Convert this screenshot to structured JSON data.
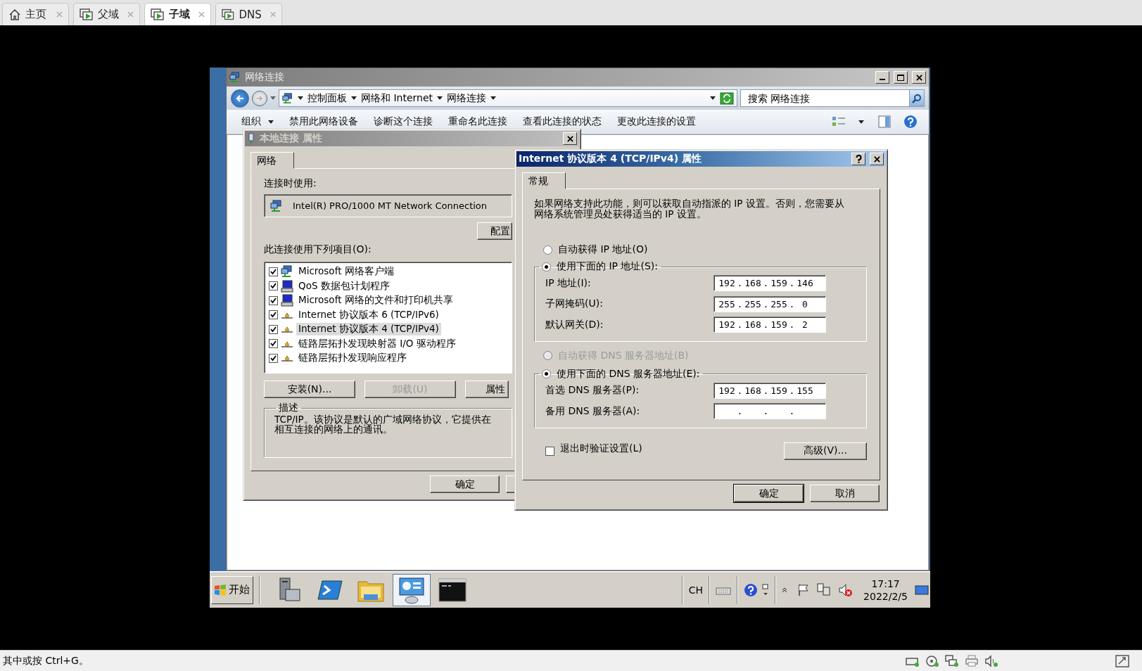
{
  "host_tabs": [
    {
      "kind": "home",
      "label": "主页",
      "selected": false
    },
    {
      "kind": "vm",
      "label": "父域",
      "selected": false
    },
    {
      "kind": "vm",
      "label": "子域",
      "selected": true
    },
    {
      "kind": "vm",
      "label": "DNS",
      "selected": false
    }
  ],
  "explorer": {
    "title": "网络连接",
    "breadcrumb": [
      "控制面板",
      "网络和 Internet",
      "网络连接"
    ],
    "search": {
      "placeholder": "搜索 网络连接"
    },
    "commands": [
      {
        "label": "组织",
        "menu": true
      },
      {
        "label": "禁用此网络设备",
        "menu": false
      },
      {
        "label": "诊断这个连接",
        "menu": false
      },
      {
        "label": "重命名此连接",
        "menu": false
      },
      {
        "label": "查看此连接的状态",
        "menu": false
      },
      {
        "label": "更改此连接的设置",
        "menu": false
      }
    ]
  },
  "local_dialog": {
    "title": "本地连接 属性",
    "tabs": [
      {
        "label": "网络",
        "selected": true
      }
    ],
    "connect_label": "连接时使用:",
    "adapter": "Intel(R) PRO/1000 MT Network Connection",
    "configure_button": "配置",
    "items_label": "此连接使用下列项目(O):",
    "items": [
      {
        "kind": "client",
        "label": "Microsoft 网络客户端",
        "checked": true,
        "selected": false
      },
      {
        "kind": "service",
        "label": "QoS 数据包计划程序",
        "checked": true,
        "selected": false
      },
      {
        "kind": "service",
        "label": "Microsoft 网络的文件和打印机共享",
        "checked": true,
        "selected": false
      },
      {
        "kind": "protocol",
        "label": "Internet 协议版本 6 (TCP/IPv6)",
        "checked": true,
        "selected": false
      },
      {
        "kind": "protocol",
        "label": "Internet 协议版本 4 (TCP/IPv4)",
        "checked": true,
        "selected": true
      },
      {
        "kind": "protocol",
        "label": "链路层拓扑发现映射器 I/O 驱动程序",
        "checked": true,
        "selected": false
      },
      {
        "kind": "protocol",
        "label": "链路层拓扑发现响应程序",
        "checked": true,
        "selected": false
      }
    ],
    "buttons": [
      {
        "label": "安装(N)...",
        "disabled": false
      },
      {
        "label": "卸载(U)",
        "disabled": true
      },
      {
        "label": "属性",
        "disabled": false
      }
    ],
    "description": {
      "legend": "描述",
      "lines": [
        "TCP/IP。该协议是默认的广域网络协议，它提供在",
        "相互连接的网络上的通讯。"
      ]
    },
    "ok_button": "确定"
  },
  "ipv4_dialog": {
    "title": "Internet 协议版本 4 (TCP/IPv4) 属性",
    "tabs": [
      {
        "label": "常规",
        "selected": true
      }
    ],
    "intro": "如果网络支持此功能，则可以获取自动指派的 IP 设置。否则，您需要从网络系统管理员处获得适当的 IP 设置。",
    "separator": ".",
    "ip_options": [
      {
        "label": "自动获得 IP 地址(O)",
        "selected": false,
        "disabled": false
      },
      {
        "label": "使用下面的 IP 地址(S):",
        "selected": true,
        "disabled": false
      }
    ],
    "ip_fields": [
      {
        "label": "IP 地址(I):",
        "octets": [
          "192",
          "168",
          "159",
          "146"
        ]
      },
      {
        "label": "子网掩码(U):",
        "octets": [
          "255",
          "255",
          "255",
          "0"
        ]
      },
      {
        "label": "默认网关(D):",
        "octets": [
          "192",
          "168",
          "159",
          "2"
        ]
      }
    ],
    "dns_options": [
      {
        "label": "自动获得 DNS 服务器地址(B)",
        "selected": false,
        "disabled": true
      },
      {
        "label": "使用下面的 DNS 服务器地址(E):",
        "selected": true,
        "disabled": false
      }
    ],
    "dns_fields": [
      {
        "label": "首选 DNS 服务器(P):",
        "octets": [
          "192",
          "168",
          "159",
          "155"
        ]
      },
      {
        "label": "备用 DNS 服务器(A):"
      }
    ],
    "validate": {
      "label": "退出时验证设置(L)",
      "checked": false
    },
    "advanced_button": "高级(V)...",
    "buttons": [
      "确定",
      "取消"
    ]
  },
  "taskbar": {
    "start": "开始",
    "apps": [
      {
        "kind": "server",
        "selected": false
      },
      {
        "kind": "powershell",
        "selected": false
      },
      {
        "kind": "folder",
        "selected": false
      },
      {
        "kind": "control-panel",
        "selected": true
      },
      {
        "kind": "console",
        "selected": false
      }
    ],
    "language": "CH",
    "time": "17:17",
    "date": "2022/2/5"
  },
  "host_status": {
    "hint": "其中或按 Ctrl+G。"
  }
}
